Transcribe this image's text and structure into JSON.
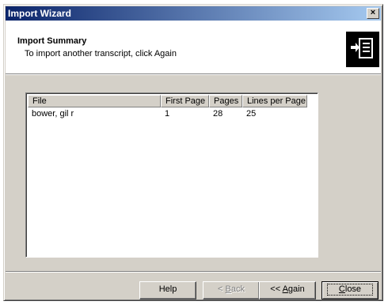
{
  "window": {
    "title": "Import Wizard",
    "close_glyph": "×"
  },
  "header": {
    "title": "Import Summary",
    "subtitle": "To import another transcript, click Again",
    "logo_icon": "import-document-icon"
  },
  "table": {
    "columns": [
      "File",
      "First Page",
      "Pages",
      "Lines per Page"
    ],
    "rows": [
      [
        "bower, gil r",
        "1",
        "28",
        "25"
      ]
    ]
  },
  "buttons": {
    "help": "Help",
    "back_accel": "B",
    "back_rest": "ack",
    "back_prefix": "< ",
    "again_prefix": "<< ",
    "again_accel": "A",
    "again_rest": "gain",
    "close_accel": "C",
    "close_rest": "lose"
  }
}
